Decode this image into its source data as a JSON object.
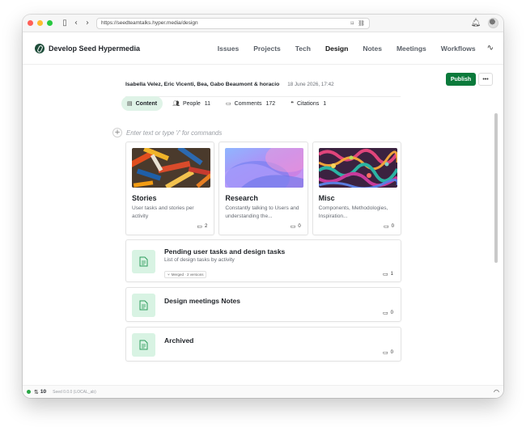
{
  "browser": {
    "url": "https://seedteamtalks.hyper.media/design"
  },
  "header": {
    "site_title": "Develop Seed Hypermedia",
    "nav": [
      "Issues",
      "Projects",
      "Tech",
      "Design",
      "Notes",
      "Meetings",
      "Workflows"
    ],
    "active_nav": "Design"
  },
  "document": {
    "authors": "Isabella Velez, Eric Vicenti, Bea, Gabo Beaumont & horacio",
    "date": "18 June 2026, 17:42",
    "publish_label": "Publish",
    "more_label": "•••",
    "tabs": [
      {
        "label": "Content",
        "count": "",
        "icon": "content-icon"
      },
      {
        "label": "People",
        "count": "11",
        "icon": "people-icon"
      },
      {
        "label": "Comments",
        "count": "172",
        "icon": "comment-icon"
      },
      {
        "label": "Citations",
        "count": "1",
        "icon": "citation-icon"
      }
    ],
    "editor_placeholder": "Enter text or type '/' for commands",
    "cards": [
      {
        "title": "Stories",
        "description": "User tasks and stories per activity",
        "comments": "2"
      },
      {
        "title": "Research",
        "description": "Constantly talking to Users and understanding the...",
        "comments": "0"
      },
      {
        "title": "Misc",
        "description": "Components, Methodologies, Inspiration...",
        "comments": "0"
      }
    ],
    "items": [
      {
        "title": "Pending user tasks and design tasks",
        "subtitle": "List of design tasks by activity",
        "badge": "Merged · 2 versions",
        "comments": "1"
      },
      {
        "title": "Design meetings Notes",
        "subtitle": "",
        "badge": "",
        "comments": "0"
      },
      {
        "title": "Archived",
        "subtitle": "",
        "badge": "",
        "comments": "0"
      }
    ]
  },
  "footer": {
    "count": "10",
    "version": "Seed 0.0.0 (LOCAL_ab)"
  },
  "colors": {
    "accent": "#0b7a3b",
    "active_tab_bg": "#dff3e7",
    "doc_thumb_bg": "#d8f3e3"
  }
}
